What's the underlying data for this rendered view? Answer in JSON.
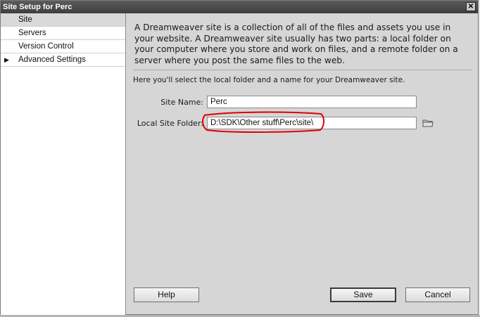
{
  "window": {
    "title": "Site Setup for Perc",
    "close_glyph": "✕"
  },
  "sidebar": {
    "items": [
      {
        "label": "Site",
        "selected": true
      },
      {
        "label": "Servers"
      },
      {
        "label": "Version Control"
      },
      {
        "label": "Advanced Settings",
        "arrow": "▶"
      }
    ]
  },
  "content": {
    "intro": "A Dreamweaver site is a collection of all of the files and assets you use in your website. A Dreamweaver site usually has two parts: a local folder on your computer where you store and work on files, and a remote folder on a server where you post the same files to the web.",
    "note": "Here you'll select the local folder and a name for your Dreamweaver site.",
    "site_name_label": "Site Name:",
    "site_name_value": "Perc",
    "local_folder_label": "Local Site Folder:",
    "local_folder_value": "D:\\SDK\\Other stuff\\Perc\\site\\",
    "annotation_color": "#e00000"
  },
  "buttons": {
    "help": "Help",
    "save": "Save",
    "cancel": "Cancel"
  },
  "icons": {
    "folder": "folder-icon",
    "close": "close-icon",
    "arrow": "triangle-right-icon"
  }
}
